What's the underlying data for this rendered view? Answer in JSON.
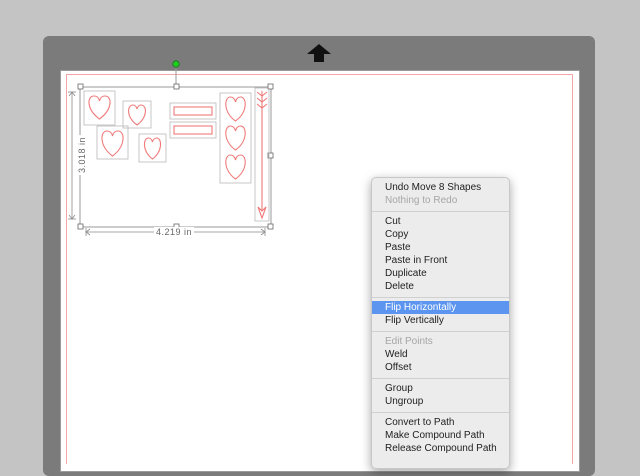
{
  "canvas": {
    "dimension_width_label": "4.219 in",
    "dimension_height_label": "3.018 in"
  },
  "icons": {
    "feed": "up-arrow-icon",
    "rotate": "rotate-handle-icon"
  },
  "colors": {
    "cut_line": "#f07a7a",
    "menu_highlight": "#5b95f0",
    "rotate_handle": "#22cc22"
  },
  "context_menu": {
    "undo": "Undo Move 8 Shapes",
    "redo": "Nothing to Redo",
    "cut": "Cut",
    "copy": "Copy",
    "paste": "Paste",
    "paste_in_front": "Paste in Front",
    "duplicate": "Duplicate",
    "delete": "Delete",
    "flip_h": "Flip Horizontally",
    "flip_v": "Flip Vertically",
    "edit_points": "Edit Points",
    "weld": "Weld",
    "offset": "Offset",
    "group": "Group",
    "ungroup": "Ungroup",
    "convert_to_path": "Convert to Path",
    "make_compound_path": "Make Compound Path",
    "release_compound_path": "Release Compound Path"
  }
}
